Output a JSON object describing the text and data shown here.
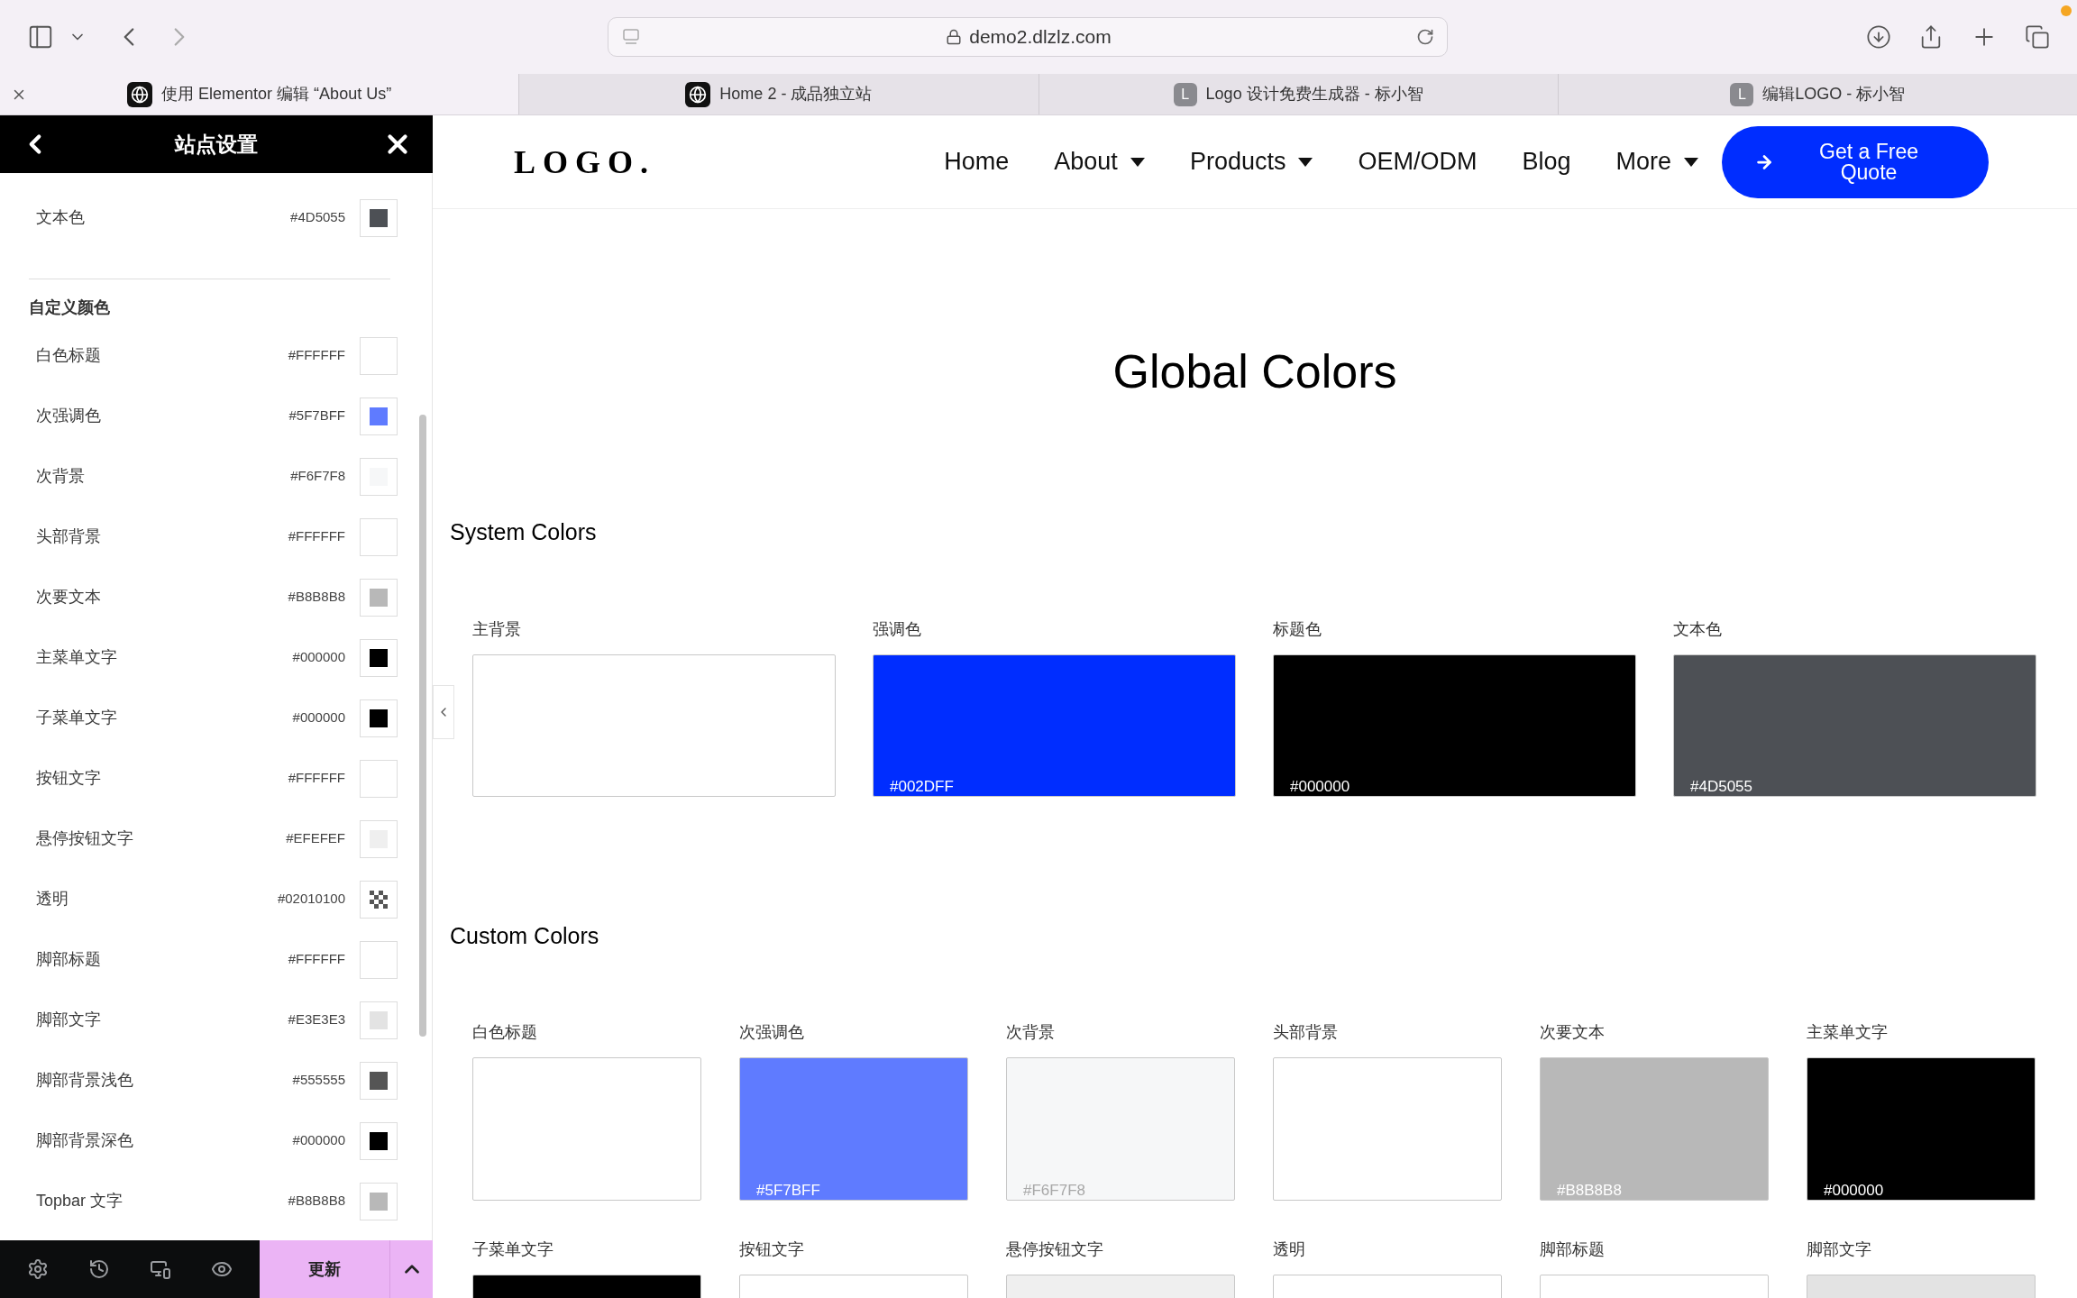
{
  "browser": {
    "url": "demo2.dlzlz.com",
    "tabs": [
      {
        "title": "使用 Elementor 编辑 “About Us”",
        "kind": "globe",
        "selected": true
      },
      {
        "title": "Home 2 - 成品独立站",
        "kind": "globe",
        "selected": false
      },
      {
        "title": "Logo 设计免费生成器 - 标小智",
        "kind": "letter",
        "icon_text": "L",
        "selected": false
      },
      {
        "title": "编辑LOGO - 标小智",
        "kind": "letter",
        "icon_text": "L",
        "selected": false
      }
    ]
  },
  "panel": {
    "title": "站点设置",
    "system_items": [
      {
        "label": "文本色",
        "hex": "#4D5055",
        "kind": "solid",
        "color": "#4d5055"
      }
    ],
    "custom_heading": "自定义颜色",
    "custom_items": [
      {
        "label": "白色标题",
        "hex": "#FFFFFF",
        "kind": "solid",
        "color": "#ffffff"
      },
      {
        "label": "次强调色",
        "hex": "#5F7BFF",
        "kind": "solid",
        "color": "#5f7bff"
      },
      {
        "label": "次背景",
        "hex": "#F6F7F8",
        "kind": "solid",
        "color": "#f6f7f8"
      },
      {
        "label": "头部背景",
        "hex": "#FFFFFF",
        "kind": "solid",
        "color": "#ffffff"
      },
      {
        "label": "次要文本",
        "hex": "#B8B8B8",
        "kind": "solid",
        "color": "#b8b8b8"
      },
      {
        "label": "主菜单文字",
        "hex": "#000000",
        "kind": "solid",
        "color": "#000000"
      },
      {
        "label": "子菜单文字",
        "hex": "#000000",
        "kind": "solid",
        "color": "#000000"
      },
      {
        "label": "按钮文字",
        "hex": "#FFFFFF",
        "kind": "solid",
        "color": "#ffffff"
      },
      {
        "label": "悬停按钮文字",
        "hex": "#EFEFEF",
        "kind": "solid",
        "color": "#efefef"
      },
      {
        "label": "透明",
        "hex": "#02010100",
        "kind": "transparent"
      },
      {
        "label": "脚部标题",
        "hex": "#FFFFFF",
        "kind": "solid",
        "color": "#ffffff"
      },
      {
        "label": "脚部文字",
        "hex": "#E3E3E3",
        "kind": "solid",
        "color": "#e3e3e3"
      },
      {
        "label": "脚部背景浅色",
        "hex": "#555555",
        "kind": "solid",
        "color": "#555555"
      },
      {
        "label": "脚部背景深色",
        "hex": "#000000",
        "kind": "solid",
        "color": "#000000"
      },
      {
        "label": "Topbar 文字",
        "hex": "#B8B8B8",
        "kind": "solid",
        "color": "#b8b8b8"
      }
    ],
    "update_button": "更新"
  },
  "site": {
    "logo": "LOGO.",
    "nav": [
      {
        "label": "Home",
        "dropdown": false
      },
      {
        "label": "About",
        "dropdown": true
      },
      {
        "label": "Products",
        "dropdown": true
      },
      {
        "label": "OEM/ODM",
        "dropdown": false
      },
      {
        "label": "Blog",
        "dropdown": false
      },
      {
        "label": "More",
        "dropdown": true
      }
    ],
    "cta": "Get a Free Quote",
    "heading": "Global Colors",
    "system_title": "System Colors",
    "system_colors": [
      {
        "label": "主背景",
        "color": "#ffffff"
      },
      {
        "label": "强调色",
        "hex": "#002DFF",
        "color": "#002dff"
      },
      {
        "label": "标题色",
        "hex": "#000000",
        "color": "#000000"
      },
      {
        "label": "文本色",
        "hex": "#4D5055",
        "color": "#4d5055"
      }
    ],
    "custom_title": "Custom Colors",
    "custom_colors": [
      {
        "label": "白色标题",
        "color": "#ffffff"
      },
      {
        "label": "次强调色",
        "hex": "#5F7BFF",
        "color": "#5f7bff"
      },
      {
        "label": "次背景",
        "hex": "#F6F7F8",
        "color": "#f6f7f8"
      },
      {
        "label": "头部背景",
        "color": "#ffffff"
      },
      {
        "label": "次要文本",
        "hex": "#B8B8B8",
        "color": "#b8b8b8"
      },
      {
        "label": "主菜单文字",
        "hex": "#000000",
        "color": "#000000"
      },
      {
        "label": "子菜单文字",
        "color": "#000000"
      },
      {
        "label": "按钮文字",
        "color": "#ffffff"
      },
      {
        "label": "悬停按钮文字",
        "color": "#efefef"
      },
      {
        "label": "透明",
        "color": "#ffffff"
      },
      {
        "label": "脚部标题",
        "color": "#ffffff"
      },
      {
        "label": "脚部文字",
        "color": "#e3e3e3"
      }
    ]
  }
}
